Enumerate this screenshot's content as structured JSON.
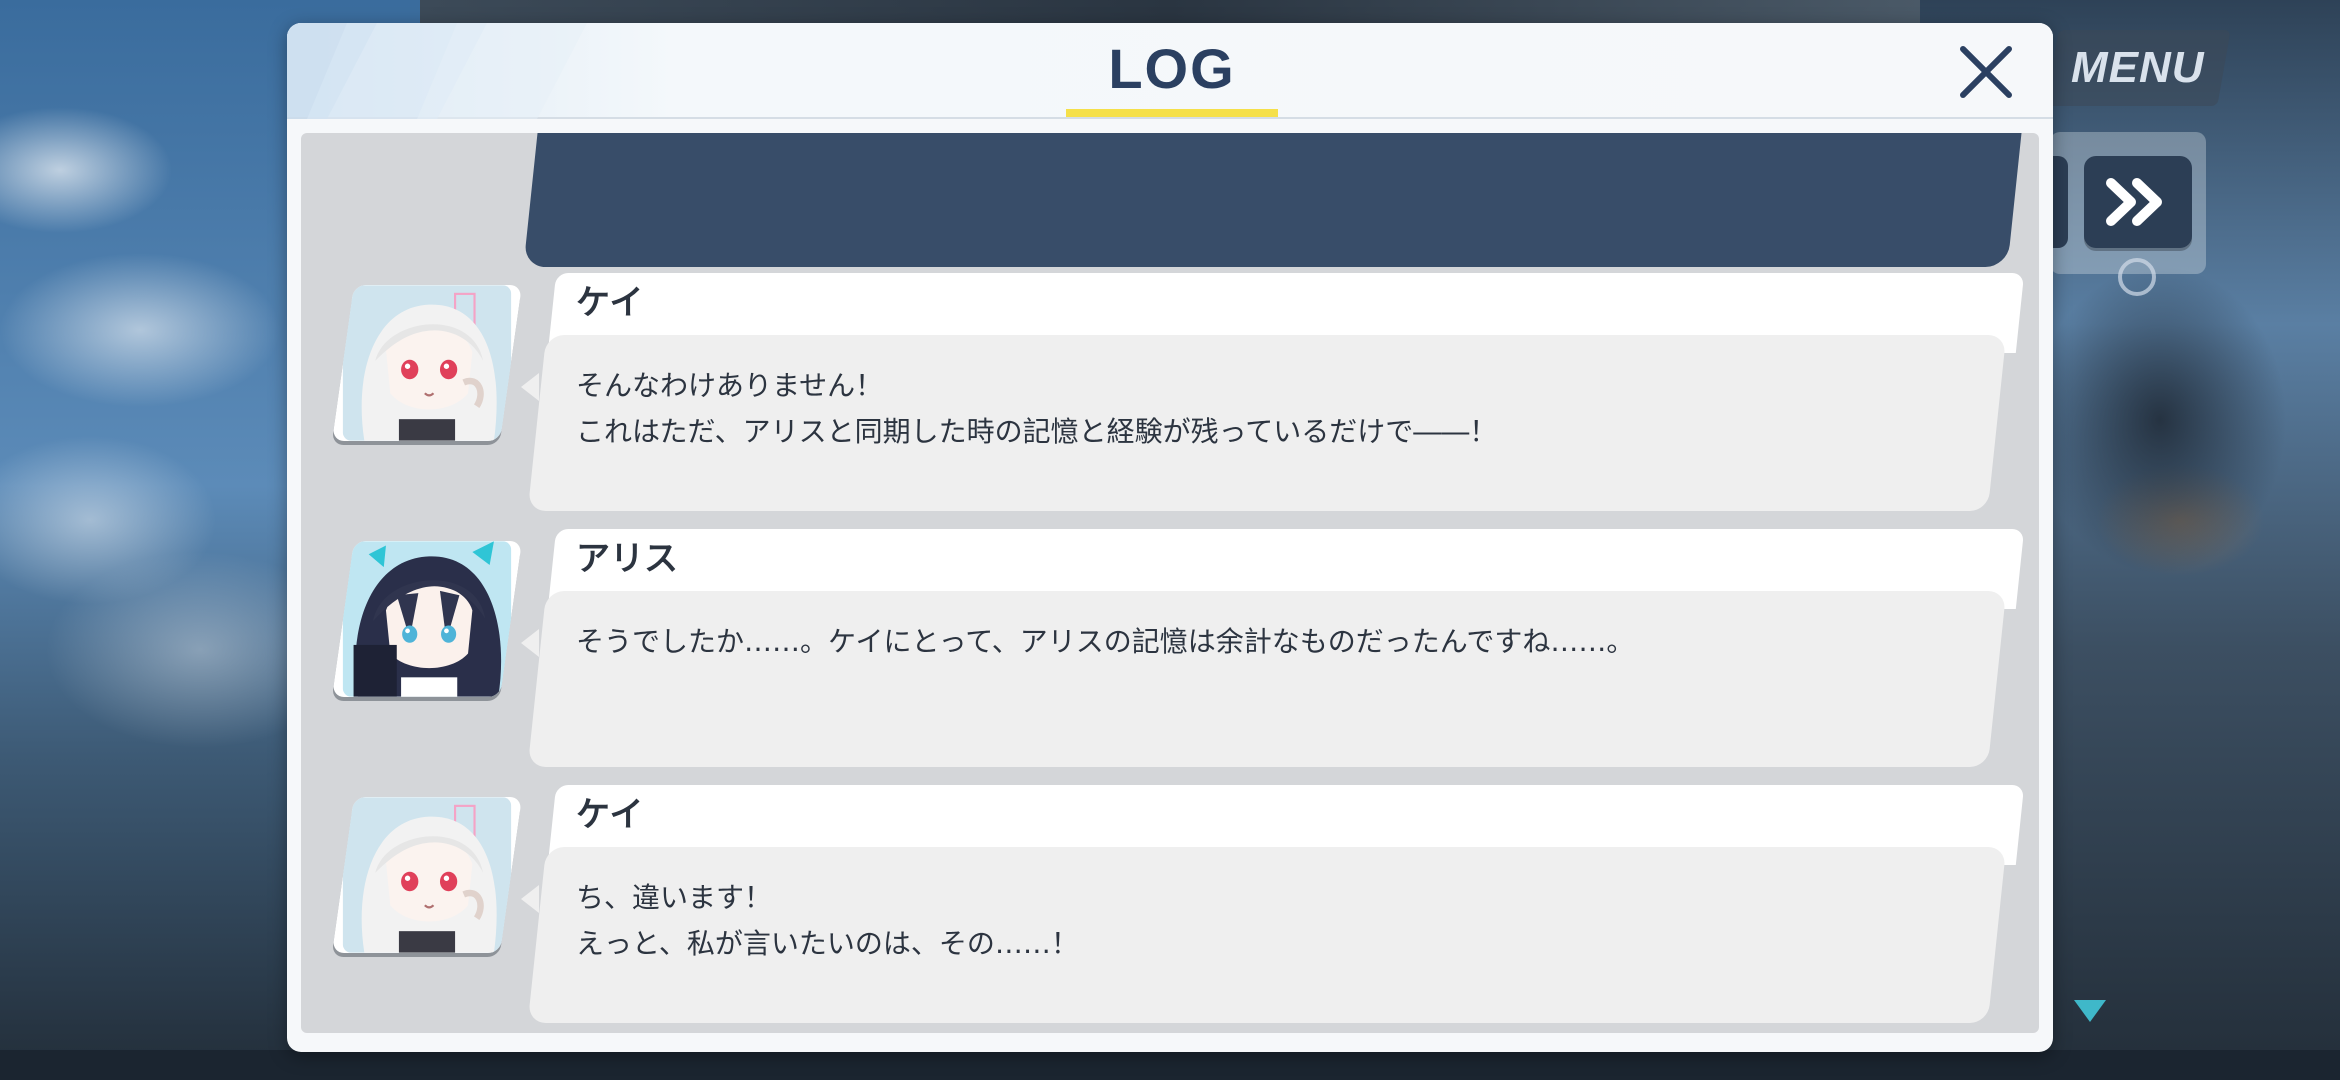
{
  "hud": {
    "menu_label": "MENU"
  },
  "log": {
    "title": "LOG",
    "entries": [
      {
        "speaker": "ケイ",
        "character": "kei",
        "lines": [
          "そんなわけありません！",
          "これはただ、アリスと同期した時の記憶と経験が残っているだけで――！"
        ]
      },
      {
        "speaker": "アリス",
        "character": "aris",
        "lines": [
          "そうでしたか……。ケイにとって、アリスの記憶は余計なものだったんですね……。"
        ]
      },
      {
        "speaker": "ケイ",
        "character": "kei",
        "lines": [
          "ち、違います！",
          "えっと、私が言いたいのは、その……！"
        ]
      }
    ]
  },
  "colors": {
    "title_underline": "#f5e04a",
    "title_text": "#2b4061",
    "previous_bubble": "#384d69",
    "dialogue_bubble": "#efefef",
    "log_body": "#d4d6d9"
  },
  "icons": {
    "close": "close-icon",
    "skip": "fast-forward-icon",
    "scroll_indicator": "triangle-down-icon"
  }
}
